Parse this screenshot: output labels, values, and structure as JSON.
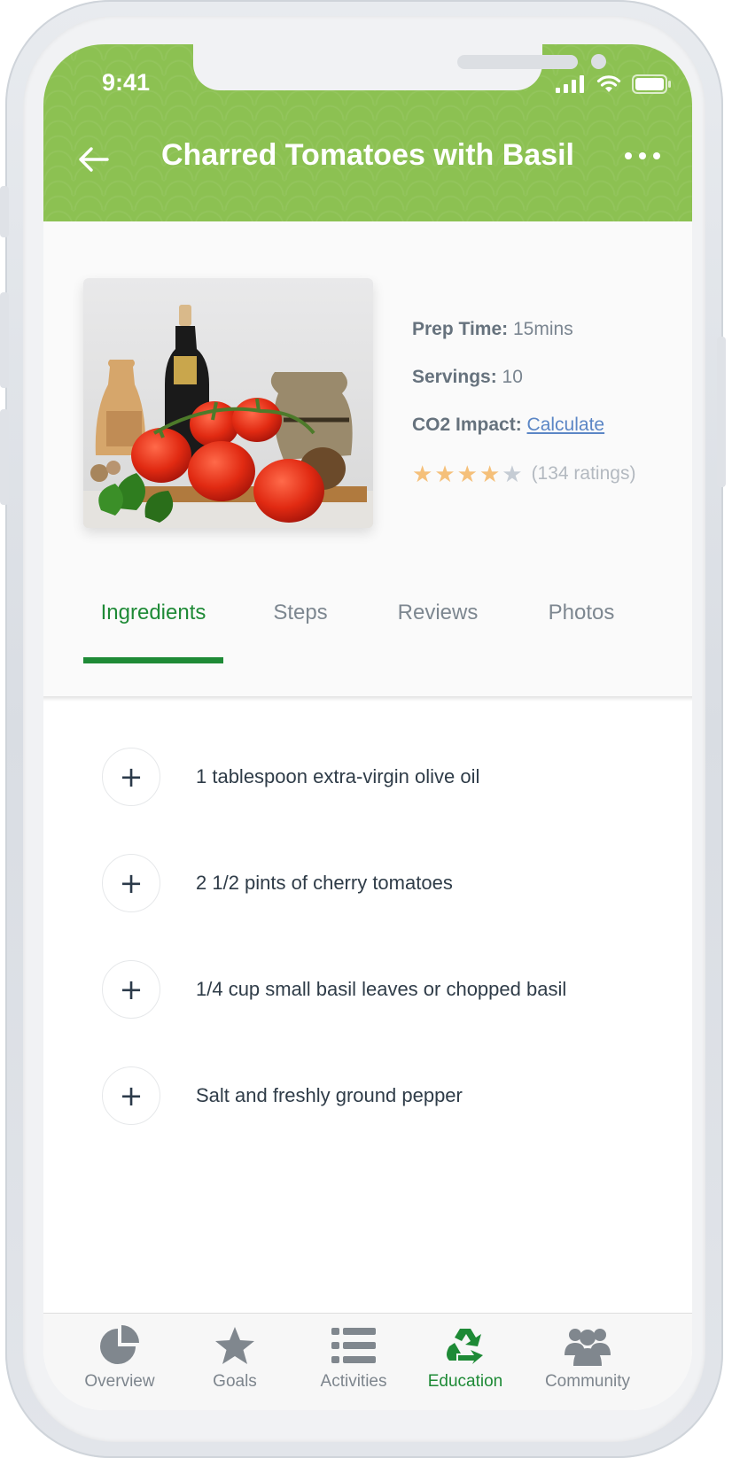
{
  "status_bar": {
    "time": "9:41"
  },
  "header": {
    "title": "Charred Tomatoes with Basil",
    "back_icon": "arrow-left-icon",
    "more_icon": "more-dots-icon",
    "background": "#8cc152"
  },
  "recipe": {
    "prep_time_label": "Prep Time:",
    "prep_time_value": "15mins",
    "servings_label": "Servings:",
    "servings_value": "10",
    "co2_label": "CO2 Impact:",
    "co2_link": "Calculate",
    "rating": 4,
    "rating_max": 5,
    "ratings_text": "(134 ratings)",
    "star_color": "#f5c07a",
    "star_empty_color": "#c5ccd4"
  },
  "tabs": [
    {
      "label": "Ingredients",
      "active": true
    },
    {
      "label": "Steps",
      "active": false
    },
    {
      "label": "Reviews",
      "active": false
    },
    {
      "label": "Photos",
      "active": false
    }
  ],
  "ingredients": [
    "1 tablespoon extra-virgin olive oil",
    "2 1/2 pints of cherry tomatoes",
    "1/4 cup small basil leaves or chopped basil",
    "Salt and freshly ground pepper"
  ],
  "tabbar": [
    {
      "label": "Overview",
      "icon": "pie-chart-icon",
      "active": false
    },
    {
      "label": "Goals",
      "icon": "star-icon",
      "active": false
    },
    {
      "label": "Activities",
      "icon": "list-icon",
      "active": false
    },
    {
      "label": "Education",
      "icon": "recycle-icon",
      "active": true
    },
    {
      "label": "Community",
      "icon": "people-icon",
      "active": false
    }
  ],
  "accent_color": "#1e8a36"
}
